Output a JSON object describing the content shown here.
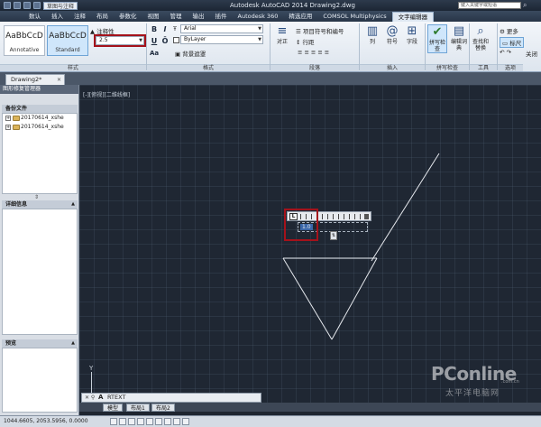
{
  "titlebar": {
    "workspace": "草图与注释",
    "title": "Autodesk AutoCAD 2014    Drawing2.dwg",
    "search_placeholder": "键入关键字或短语"
  },
  "ribbon_tabs": [
    "数认",
    "插入",
    "注释",
    "布局",
    "参数化",
    "视图",
    "管理",
    "输出",
    "插件",
    "Autodesk 360",
    "精选应用",
    "COMSOL Multiphysics",
    "文字编辑器"
  ],
  "active_tab": "文字编辑器",
  "style_panel": {
    "tiles": [
      {
        "sample": "AaBbCcD",
        "name": "Annotative"
      },
      {
        "sample": "AaBbCcD",
        "name": "Standard"
      }
    ],
    "annotative_label": "注释性",
    "height_value": "2.5",
    "label": "样式"
  },
  "format_panel": {
    "bold": "B",
    "italic": "I",
    "underline": "U",
    "overline": "Ō",
    "font": "Arial",
    "color": "ByLayer",
    "mask": "背景遮罩",
    "case": "Aa",
    "label": "格式"
  },
  "paragraph_panel": {
    "justify": "对正",
    "bullets": "项目符号和编号",
    "line_spacing": "行距",
    "label": "段落"
  },
  "insert_panel": {
    "column": "列",
    "symbol": "符号",
    "field": "字段",
    "label": "插入"
  },
  "spell_panel": {
    "spell_check": "拼写检查",
    "edit_dict": "编辑词典",
    "label": "拼写检查"
  },
  "tools_panel": {
    "find_replace": "查找和替换",
    "label": "工具"
  },
  "options_panel": {
    "more": "更多",
    "ruler": "标尺",
    "label": "选项"
  },
  "close_label": "关闭",
  "doc_tab": "Drawing2*",
  "palette": {
    "title": "图形修复管理器",
    "backup_header": "备份文件",
    "files": [
      "20170614_xshe",
      "20170614_xshe"
    ],
    "details_header": "详细信息",
    "preview_header": "预览"
  },
  "view_label": "[-][俯视][二维线框]",
  "editor": {
    "ruler_button": "L",
    "text_value": "1.0"
  },
  "axis_y": "Y",
  "command": {
    "prompt": "A",
    "text": "RTEXT"
  },
  "layout_tabs": [
    "模型",
    "布局1",
    "布局2"
  ],
  "status": {
    "coords": "1044.6605, 2053.5956, 0.0000"
  },
  "watermark": {
    "main": "PConline",
    "sub": "太平洋电脑网",
    "domain": ".com.cn"
  }
}
